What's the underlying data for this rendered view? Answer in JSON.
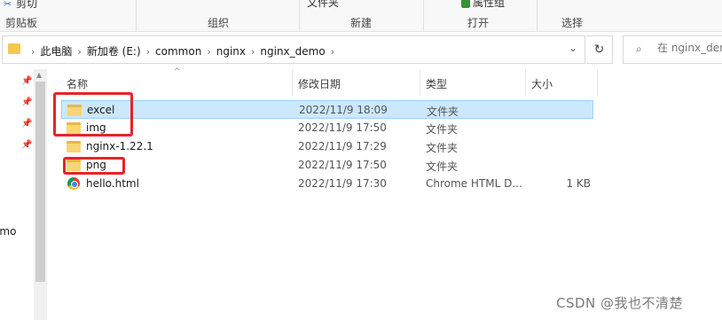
{
  "ribbon": {
    "cut_label": "剪切",
    "new_folder_cut": "文件夹",
    "props_cut": "属性组",
    "groups": {
      "clipboard": "剪贴板",
      "organize": "组织",
      "new": "新建",
      "open": "打开",
      "select": "选择"
    }
  },
  "address": {
    "crumbs": [
      "此电脑",
      "新加卷 (E:)",
      "common",
      "nginx",
      "nginx_demo"
    ]
  },
  "search": {
    "placeholder": "在 nginx_demo"
  },
  "nav": {
    "partial_label": "emo"
  },
  "columns": {
    "name": "名称",
    "date": "修改日期",
    "type": "类型",
    "size": "大小"
  },
  "files": [
    {
      "name": "excel",
      "date": "2022/11/9 18:09",
      "type": "文件夹",
      "size": "",
      "icon": "folder-icon",
      "selected": true
    },
    {
      "name": "img",
      "date": "2022/11/9 17:50",
      "type": "文件夹",
      "size": "",
      "icon": "folder-icon"
    },
    {
      "name": "nginx-1.22.1",
      "date": "2022/11/9 17:29",
      "type": "文件夹",
      "size": "",
      "icon": "folder-icon"
    },
    {
      "name": "png",
      "date": "2022/11/9 17:50",
      "type": "文件夹",
      "size": "",
      "icon": "folder-icon"
    },
    {
      "name": "hello.html",
      "date": "2022/11/9 17:30",
      "type": "Chrome HTML D...",
      "size": "1 KB",
      "icon": "chrome-icon"
    }
  ],
  "watermark": "CSDN @我也不清楚",
  "colors": {
    "selection": "#cce8ff",
    "highlight": "#e8232a",
    "folder": "#f8d575"
  }
}
